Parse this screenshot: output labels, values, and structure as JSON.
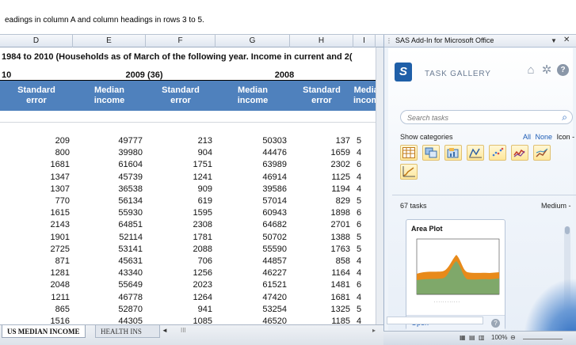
{
  "formula_bar": {
    "text": "eadings in column A and column headings in rows 3 to 5."
  },
  "columns": [
    "D",
    "E",
    "F",
    "G",
    "H",
    "I"
  ],
  "sheet": {
    "title": "1984 to 2010 (Households as of March of the following year.  Income in current and 2(",
    "year_left_fragment": "10",
    "year_2009": "2009 (36)",
    "year_2008": "2008",
    "headers": [
      "Standard\nerror",
      "Median\nincome",
      "Standard\nerror",
      "Median\nincome",
      "Standard\nerror",
      "Media\nincom"
    ],
    "rows": [
      [
        "209",
        "49777",
        "213",
        "50303",
        "137",
        "5"
      ],
      [
        "800",
        "39980",
        "904",
        "44476",
        "1659",
        "4"
      ],
      [
        "1681",
        "61604",
        "1751",
        "63989",
        "2302",
        "6"
      ],
      [
        "1347",
        "45739",
        "1241",
        "46914",
        "1125",
        "4"
      ],
      [
        "1307",
        "36538",
        "909",
        "39586",
        "1194",
        "4"
      ],
      [
        "770",
        "56134",
        "619",
        "57014",
        "829",
        "5"
      ],
      [
        "1615",
        "55930",
        "1595",
        "60943",
        "1898",
        "6"
      ],
      [
        "2143",
        "64851",
        "2308",
        "64682",
        "2701",
        "6"
      ],
      [
        "1901",
        "52114",
        "1781",
        "50702",
        "1388",
        "5"
      ],
      [
        "2725",
        "53141",
        "2088",
        "55590",
        "1763",
        "5"
      ],
      [
        "871",
        "45631",
        "706",
        "44857",
        "858",
        "4"
      ],
      [
        "1281",
        "43340",
        "1256",
        "46227",
        "1164",
        "4"
      ],
      [
        "2048",
        "55649",
        "2023",
        "61521",
        "1481",
        "6"
      ],
      [
        "1211",
        "46778",
        "1264",
        "47420",
        "1681",
        "4"
      ],
      [
        "865",
        "52870",
        "941",
        "53254",
        "1325",
        "5"
      ],
      [
        "1516",
        "44305",
        "1085",
        "46520",
        "1185",
        "4"
      ]
    ]
  },
  "sheet_tabs": {
    "active": "US MEDIAN INCOME",
    "inactive": "HEALTH INS",
    "nav_left": "◄",
    "nav_scroll": "III"
  },
  "task_pane": {
    "title": "SAS Add-In for Microsoft Office",
    "logo": "S",
    "gallery_title": "TASK GALLERY",
    "icons": [
      "home-icon",
      "gear-icon",
      "help-icon"
    ],
    "search_placeholder": "Search tasks",
    "show_categories": "Show categories",
    "all_link": "All",
    "none_link": "None",
    "icon_link": "Icon -",
    "tasks_count": "67 tasks",
    "size_link": "Medium -",
    "card": {
      "title": "Area Plot",
      "open": "Open",
      "help": "?"
    },
    "colors": {
      "accent": "#1f5fa8",
      "category_bg": "#ffe79a",
      "plot_orange": "#e88a1a",
      "plot_green": "#7fa86a"
    }
  },
  "status_bar": {
    "zoom": "100%"
  }
}
